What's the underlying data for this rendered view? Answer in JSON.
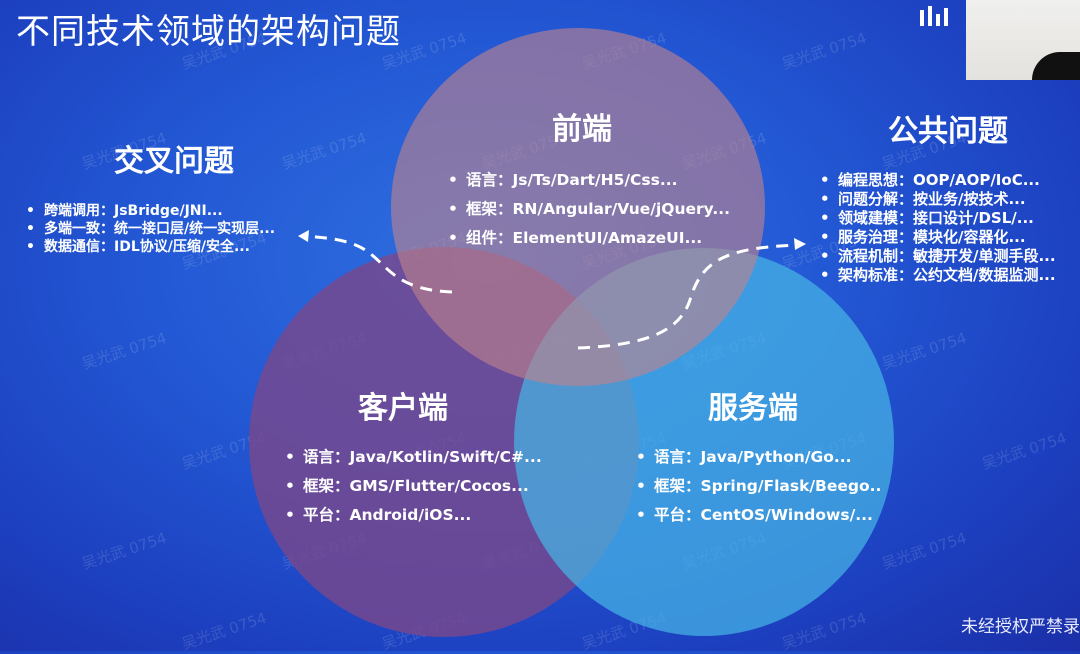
{
  "title": "不同技术领域的架构问题",
  "frontend": {
    "heading": "前端",
    "items": [
      "语言：Js/Ts/Dart/H5/Css...",
      "框架：RN/Angular/Vue/jQuery...",
      "组件：ElementUI/AmazeUI..."
    ]
  },
  "client": {
    "heading": "客户端",
    "items": [
      "语言：Java/Kotlin/Swift/C#...",
      "框架：GMS/Flutter/Cocos...",
      "平台：Android/iOS..."
    ]
  },
  "server": {
    "heading": "服务端",
    "items": [
      "语言：Java/Python/Go...",
      "框架：Spring/Flask/Beego..",
      "平台：CentOS/Windows/..."
    ]
  },
  "cross": {
    "heading": "交叉问题",
    "items": [
      "跨端调用：JsBridge/JNI...",
      "多端一致：统一接口层/统一实现层...",
      "数据通信：IDL协议/压缩/安全..."
    ]
  },
  "common": {
    "heading": "公共问题",
    "items": [
      "编程思想：OOP/AOP/IoC...",
      "问题分解：按业务/按技术...",
      "领域建模：接口设计/DSL/...",
      "服务治理：模块化/容器化...",
      "流程机制：敏捷开发/单测手段...",
      "架构标准：公约文档/数据监测..."
    ]
  },
  "footer": "未经授权严禁录",
  "watermark": "吴光武 0754",
  "colors": {
    "frontend_circle": "#9a8296",
    "client_circle": "#7a4e8c",
    "server_circle": "#3aa9dc",
    "arrow": "#ffffff"
  }
}
